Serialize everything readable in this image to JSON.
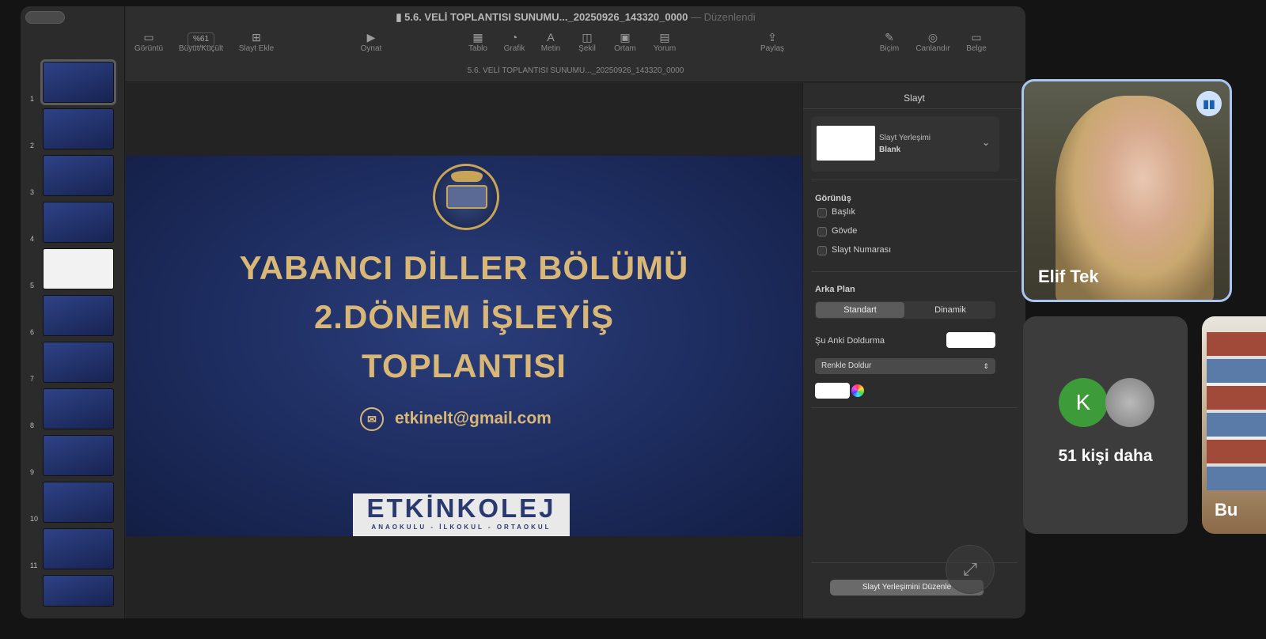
{
  "document": {
    "filename": "5.6. VELİ TOPLANTISI SUNUMU..._20250926_143320_0000",
    "edited_status": "— Düzenlendi",
    "subtitle": "5.6. VELİ TOPLANTISI SUNUMU..._20250926_143320_0000"
  },
  "toolbar": {
    "zoom_value": "%61",
    "items": [
      {
        "label": "Görüntü",
        "icon": "sidebar-icon"
      },
      {
        "label": "Büyüt/Küçült",
        "icon": "zoom-icon"
      },
      {
        "label": "Slayt Ekle",
        "icon": "add-slide-icon"
      },
      {
        "label": "Oynat",
        "icon": "play-icon"
      },
      {
        "label": "Tablo",
        "icon": "table-icon"
      },
      {
        "label": "Grafik",
        "icon": "chart-icon"
      },
      {
        "label": "Metin",
        "icon": "text-icon"
      },
      {
        "label": "Şekil",
        "icon": "shape-icon"
      },
      {
        "label": "Ortam",
        "icon": "media-icon"
      },
      {
        "label": "Yorum",
        "icon": "comment-icon"
      },
      {
        "label": "Paylaş",
        "icon": "share-icon"
      },
      {
        "label": "Biçim",
        "icon": "format-icon"
      },
      {
        "label": "Canlandır",
        "icon": "animate-icon"
      },
      {
        "label": "Belge",
        "icon": "document-icon"
      }
    ]
  },
  "slides": {
    "numbers": [
      "1",
      "2",
      "3",
      "4",
      "5",
      "6",
      "7",
      "8",
      "9",
      "10",
      "11"
    ],
    "selected": "1"
  },
  "slide": {
    "title_line1": "YABANCI DİLLER BÖLÜMÜ",
    "title_line2": "2.DÖNEM İŞLEYİŞ",
    "title_line3": "TOPLANTISI",
    "email": "etkinelt@gmail.com",
    "logo_text": "ETKİNKOLEJ",
    "logo_sub": "ANAOKULU - İLKOKUL - ORTAOKUL"
  },
  "inspector": {
    "header": "Slayt",
    "layout_label": "Slayt Yerleşimi",
    "layout_value": "Blank",
    "appearance_heading": "Görünüş",
    "checkboxes": [
      "Başlık",
      "Gövde",
      "Slayt Numarası"
    ],
    "background_heading": "Arka Plan",
    "bg_tabs": [
      "Standart",
      "Dinamik"
    ],
    "current_fill_label": "Şu Anki Doldurma",
    "fill_type": "Renkle Doldur",
    "edit_layout_button": "Slayt Yerleşimini Düzenle"
  },
  "meeting": {
    "speaker_name": "Elif Tek",
    "avatar_letter": "K",
    "others_count": "51 kişi daha",
    "cut_name": "Bu"
  },
  "colors": {
    "slide_text": "#d9b777",
    "avatar_green": "#3e9b3a",
    "speaker_border": "#a8c6f0"
  }
}
